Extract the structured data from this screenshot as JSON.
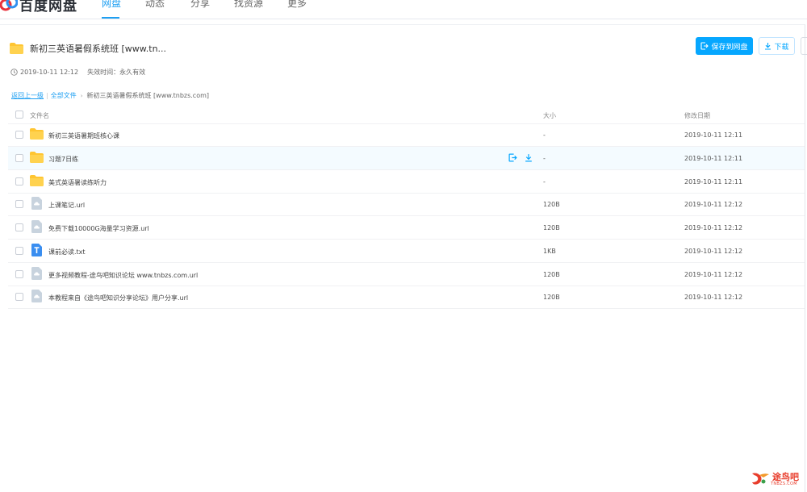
{
  "app": {
    "logo_text": "百度网盘",
    "brand_color": "#06a7ff"
  },
  "nav": {
    "items": [
      {
        "label": "网盘",
        "active": true
      },
      {
        "label": "动态",
        "active": false
      },
      {
        "label": "分享",
        "active": false
      },
      {
        "label": "找资源",
        "active": false
      },
      {
        "label": "更多",
        "active": false
      }
    ]
  },
  "share": {
    "title": "新初三英语暑假系统班  [www.tn...",
    "created": "2019-10-11 12:12",
    "expiry_label": "失效时间：",
    "expiry_value": "永久有效",
    "save_button": "保存到网盘",
    "download_button": "下载"
  },
  "breadcrumb": {
    "back": "返回上一级",
    "all_files": "全部文件",
    "current": "新初三英语暑假系统班 [www.tnbzs.com]"
  },
  "table": {
    "headers": {
      "name": "文件名",
      "size": "大小",
      "date": "修改日期"
    },
    "rows": [
      {
        "name": "新初三英语暑期班核心课",
        "size": "-",
        "date": "2019-10-11 12:11",
        "type": "folder-icon"
      },
      {
        "name": "习题7日练",
        "size": "-",
        "date": "2019-10-11 12:11",
        "type": "folder-icon"
      },
      {
        "name": "美式英语暑读练听力",
        "size": "-",
        "date": "2019-10-11 12:11",
        "type": "folder-icon"
      },
      {
        "name": "上课笔记.url",
        "size": "120B",
        "date": "2019-10-11 12:12",
        "type": "link-file-icon"
      },
      {
        "name": "免费下载10000G海量学习资源.url",
        "size": "120B",
        "date": "2019-10-11 12:12",
        "type": "link-file-icon"
      },
      {
        "name": "课前必读.txt",
        "size": "1KB",
        "date": "2019-10-11 12:12",
        "type": "text-file-icon"
      },
      {
        "name": "更多视频教程-途鸟吧知识论坛 www.tnbzs.com.url",
        "size": "120B",
        "date": "2019-10-11 12:12",
        "type": "link-file-icon"
      },
      {
        "name": "本教程来自《途鸟吧知识分享论坛》用户分享.url",
        "size": "120B",
        "date": "2019-10-11 12:12",
        "type": "link-file-icon"
      }
    ]
  },
  "watermark": {
    "text": "途鸟吧",
    "sub": "TNBZS.COM"
  }
}
